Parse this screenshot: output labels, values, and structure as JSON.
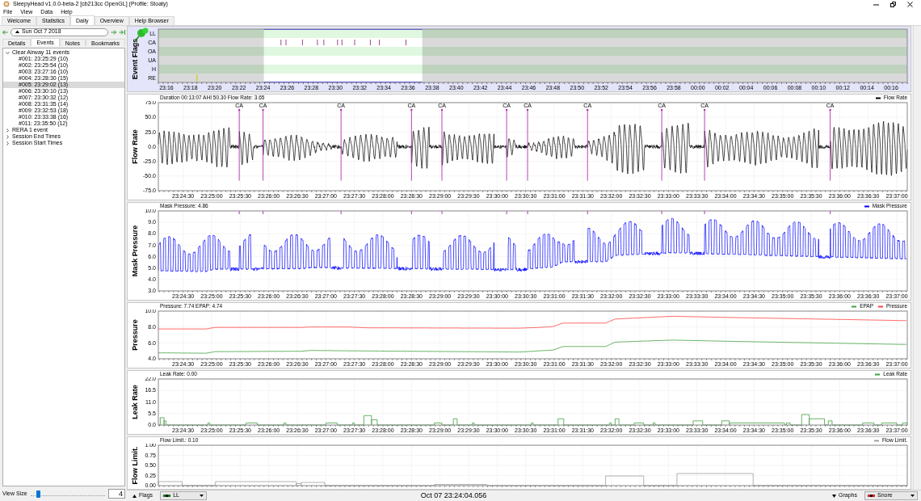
{
  "window": {
    "title": "SleepyHead v1.0.0-beta-2 [cb213cc OpenGL] (Profile: Stoaty)"
  },
  "menu": [
    "File",
    "View",
    "Data",
    "Help"
  ],
  "tabs": [
    {
      "label": "Welcome",
      "selected": false
    },
    {
      "label": "Statistics",
      "selected": false
    },
    {
      "label": "Daily",
      "selected": true
    },
    {
      "label": "Overview",
      "selected": false
    },
    {
      "label": "Help Browser",
      "selected": false
    }
  ],
  "sidebar": {
    "date": "Sun Oct 7 2018",
    "tabs": [
      {
        "label": "Details",
        "selected": false
      },
      {
        "label": "Events",
        "selected": true
      },
      {
        "label": "Notes",
        "selected": false
      },
      {
        "label": "Bookmarks",
        "selected": false
      }
    ],
    "tree": [
      {
        "label": "Clear Airway 11 events",
        "expanded": true,
        "children": [
          {
            "label": "#001: 23:25:29 (10)",
            "selected": false
          },
          {
            "label": "#002: 23:25:54 (10)",
            "selected": false
          },
          {
            "label": "#003: 23:27:16 (10)",
            "selected": false
          },
          {
            "label": "#004: 23:28:30 (15)",
            "selected": false
          },
          {
            "label": "#005: 23:29:02 (13)",
            "selected": true
          },
          {
            "label": "#006: 23:30:10 (13)",
            "selected": false
          },
          {
            "label": "#007: 23:30:32 (12)",
            "selected": false
          },
          {
            "label": "#008: 23:31:35 (14)",
            "selected": false
          },
          {
            "label": "#009: 23:32:53 (18)",
            "selected": false
          },
          {
            "label": "#010: 23:33:38 (16)",
            "selected": false
          },
          {
            "label": "#011: 23:35:50 (12)",
            "selected": false
          }
        ]
      },
      {
        "label": "RERA 1 event",
        "expanded": false
      },
      {
        "label": "Session End Times",
        "expanded": false
      },
      {
        "label": "Session Start Times",
        "expanded": false
      }
    ],
    "view_size": {
      "label": "View Size",
      "level": 0.08,
      "value": "4"
    }
  },
  "event_flags": {
    "title": "Event Flags",
    "rows": [
      "LL",
      "CA",
      "OA",
      "UA",
      "H",
      "RE"
    ],
    "xticks": [
      "23:16",
      "23:18",
      "23:20",
      "23:22",
      "23:24",
      "23:26",
      "23:28",
      "23:30",
      "23:32",
      "23:34",
      "23:36",
      "23:38",
      "23:40",
      "23:42",
      "23:44",
      "23:46",
      "23:48",
      "23:50",
      "23:52",
      "23:54",
      "23:56",
      "23:58",
      "00:00",
      "00:02",
      "00:04",
      "00:06",
      "00:08",
      "00:10",
      "00:12",
      "00:14",
      "00:16"
    ]
  },
  "graphs": [
    {
      "kind": "flow",
      "title": "Flow Rate",
      "header": "Duration 00:13:07 AHI 50.30 Flow Rate: 3.65",
      "legend": [
        {
          "label": "Flow Rate",
          "color": "#000000"
        }
      ],
      "yticks": [
        "75.0",
        "50.0",
        "25.0",
        "0.0",
        "-25.0",
        "-50.0",
        "-75.0"
      ],
      "event_labels": [
        "CA",
        "CA",
        "CA",
        "CA",
        "CA",
        "CA",
        "CA",
        "CA",
        "CA",
        "CA",
        "CA"
      ],
      "xticks": [
        "23:24:30",
        "23:25:00",
        "23:25:30",
        "23:26:00",
        "23:26:30",
        "23:27:00",
        "23:27:30",
        "23:28:00",
        "23:28:30",
        "23:29:00",
        "23:29:30",
        "23:30:00",
        "23:30:30",
        "23:31:00",
        "23:31:30",
        "23:32:00",
        "23:32:30",
        "23:33:00",
        "23:33:30",
        "23:34:00",
        "23:34:30",
        "23:35:00",
        "23:35:30",
        "23:36:00",
        "23:36:30",
        "23:37:00"
      ]
    },
    {
      "kind": "mask",
      "title": "Mask Pressure",
      "header": "Mask Pressure: 4.86",
      "legend": [
        {
          "label": "Mask Pressure",
          "color": "#0000ff"
        }
      ],
      "yticks": [
        "10.0",
        "9.0",
        "8.0",
        "7.0",
        "6.0",
        "5.0",
        "4.0",
        "3.0"
      ],
      "xticks": [
        "23:24:30",
        "23:25:00",
        "23:25:30",
        "23:26:00",
        "23:26:30",
        "23:27:00",
        "23:27:30",
        "23:28:00",
        "23:28:30",
        "23:29:00",
        "23:29:30",
        "23:30:00",
        "23:30:30",
        "23:31:00",
        "23:31:30",
        "23:32:00",
        "23:32:30",
        "23:33:00",
        "23:33:30",
        "23:34:00",
        "23:34:30",
        "23:35:00",
        "23:35:30",
        "23:36:00",
        "23:36:30",
        "23:37:00"
      ]
    },
    {
      "kind": "pressure",
      "title": "Pressure",
      "header": "Pressure: 7.74 EPAP: 4.74",
      "legend": [
        {
          "label": "EPAP",
          "color": "#40a040"
        },
        {
          "label": "Pressure",
          "color": "#ff4040"
        }
      ],
      "yticks": [
        "10.0",
        "8.0",
        "6.0",
        "4.0"
      ],
      "xticks": [
        "23:24:30",
        "23:25:00",
        "23:25:30",
        "23:26:00",
        "23:26:30",
        "23:27:00",
        "23:27:30",
        "23:28:00",
        "23:28:30",
        "23:29:00",
        "23:29:30",
        "23:30:00",
        "23:30:30",
        "23:31:00",
        "23:31:30",
        "23:32:00",
        "23:32:30",
        "23:33:00",
        "23:33:30",
        "23:34:00",
        "23:34:30",
        "23:35:00",
        "23:35:30",
        "23:36:00",
        "23:36:30",
        "23:37:00"
      ]
    },
    {
      "kind": "leak",
      "title": "Leak Rate",
      "header": "Leak Rate: 0.00",
      "legend": [
        {
          "label": "Leak Rate",
          "color": "#40a040"
        }
      ],
      "yticks": [
        "22.0",
        "16.5",
        "11.0",
        "5.5",
        "0.0"
      ],
      "xticks": [
        "23:24:30",
        "23:25:00",
        "23:25:30",
        "23:26:00",
        "23:26:30",
        "23:27:00",
        "23:27:30",
        "23:28:00",
        "23:28:30",
        "23:29:00",
        "23:29:30",
        "23:30:00",
        "23:30:30",
        "23:31:00",
        "23:31:30",
        "23:32:00",
        "23:32:30",
        "23:33:00",
        "23:33:30",
        "23:34:00",
        "23:34:30",
        "23:35:00",
        "23:35:30",
        "23:36:00",
        "23:36:30",
        "23:37:00"
      ]
    },
    {
      "kind": "limit",
      "title": "Flow Limit.",
      "header": "Flow Limit.: 0.10",
      "legend": [
        {
          "label": "Flow Limit.",
          "color": "#a0a0a0"
        }
      ],
      "yticks": [
        "1.00",
        "0.75",
        "0.50",
        "0.25",
        "0.00"
      ]
    }
  ],
  "bottom_bar": {
    "flags_button": "Flags",
    "flags_select": "LL",
    "time": "Oct 07 23:24:04.056",
    "graphs_button": "Graphs",
    "graphs_select": "Snore"
  }
}
